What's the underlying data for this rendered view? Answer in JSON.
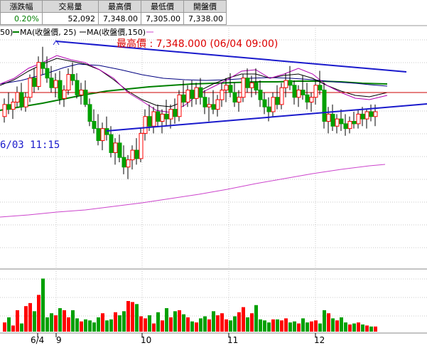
{
  "quote_table": {
    "headers": [
      "漲跌幅",
      "交易量",
      "最高價",
      "最低價",
      "開盤價"
    ],
    "values": [
      "0.20%",
      "52,092",
      "7,348.00",
      "7,305.00",
      "7,338.00"
    ]
  },
  "legend": {
    "ma_fragment_prefix": "50)",
    "ma25_label": "MA(收盤價, 25)",
    "ma150_label": "MA(收盤價,150)",
    "ma25_color": "#008000",
    "ma150_color": "#cc44cc"
  },
  "annotations": {
    "high_label": "最高價 : 7,348.000 (06/04 09:00)",
    "date_label": "6/03 11:15"
  },
  "colors": {
    "up": "#ff0000",
    "down": "#00a000",
    "trendline": "#1a1acc",
    "reference_line": "#cc0000",
    "ma_short": "#000080"
  },
  "chart_data": {
    "type": "candlestick",
    "x_labels": [
      "6/4",
      "9",
      "10",
      "11",
      "12"
    ],
    "candles": [
      [
        7290,
        7305,
        7285,
        7300
      ],
      [
        7300,
        7310,
        7292,
        7296
      ],
      [
        7296,
        7305,
        7288,
        7302
      ],
      [
        7302,
        7315,
        7298,
        7310
      ],
      [
        7310,
        7318,
        7295,
        7298
      ],
      [
        7298,
        7310,
        7294,
        7306
      ],
      [
        7306,
        7325,
        7302,
        7322
      ],
      [
        7322,
        7330,
        7310,
        7315
      ],
      [
        7315,
        7340,
        7312,
        7335
      ],
      [
        7335,
        7348,
        7325,
        7330
      ],
      [
        7330,
        7340,
        7318,
        7322
      ],
      [
        7322,
        7332,
        7310,
        7314
      ],
      [
        7314,
        7326,
        7306,
        7320
      ],
      [
        7320,
        7328,
        7300,
        7305
      ],
      [
        7305,
        7316,
        7298,
        7312
      ],
      [
        7312,
        7330,
        7308,
        7325
      ],
      [
        7325,
        7335,
        7316,
        7320
      ],
      [
        7320,
        7326,
        7305,
        7308
      ],
      [
        7308,
        7318,
        7300,
        7312
      ],
      [
        7312,
        7320,
        7298,
        7300
      ],
      [
        7300,
        7305,
        7282,
        7286
      ],
      [
        7286,
        7296,
        7276,
        7280
      ],
      [
        7280,
        7292,
        7266,
        7270
      ],
      [
        7270,
        7285,
        7262,
        7280
      ],
      [
        7280,
        7290,
        7270,
        7275
      ],
      [
        7275,
        7282,
        7256,
        7260
      ],
      [
        7260,
        7272,
        7250,
        7268
      ],
      [
        7268,
        7275,
        7252,
        7256
      ],
      [
        7256,
        7266,
        7242,
        7248
      ],
      [
        7248,
        7258,
        7238,
        7254
      ],
      [
        7254,
        7266,
        7246,
        7262
      ],
      [
        7262,
        7272,
        7250,
        7255
      ],
      [
        7255,
        7280,
        7252,
        7276
      ],
      [
        7276,
        7296,
        7270,
        7290
      ],
      [
        7290,
        7300,
        7278,
        7282
      ],
      [
        7282,
        7298,
        7276,
        7294
      ],
      [
        7294,
        7300,
        7282,
        7286
      ],
      [
        7286,
        7296,
        7276,
        7292
      ],
      [
        7292,
        7304,
        7282,
        7288
      ],
      [
        7288,
        7300,
        7280,
        7296
      ],
      [
        7296,
        7305,
        7284,
        7290
      ],
      [
        7290,
        7312,
        7286,
        7308
      ],
      [
        7308,
        7320,
        7298,
        7302
      ],
      [
        7302,
        7316,
        7298,
        7312
      ],
      [
        7312,
        7320,
        7298,
        7305
      ],
      [
        7305,
        7318,
        7300,
        7314
      ],
      [
        7314,
        7322,
        7300,
        7306
      ],
      [
        7306,
        7312,
        7292,
        7298
      ],
      [
        7298,
        7306,
        7286,
        7300
      ],
      [
        7300,
        7312,
        7292,
        7296
      ],
      [
        7296,
        7308,
        7290,
        7304
      ],
      [
        7304,
        7318,
        7298,
        7312
      ],
      [
        7312,
        7322,
        7302,
        7316
      ],
      [
        7316,
        7326,
        7306,
        7310
      ],
      [
        7310,
        7318,
        7298,
        7302
      ],
      [
        7302,
        7312,
        7294,
        7306
      ],
      [
        7306,
        7325,
        7302,
        7322
      ],
      [
        7322,
        7330,
        7310,
        7314
      ],
      [
        7314,
        7324,
        7306,
        7318
      ],
      [
        7318,
        7330,
        7308,
        7312
      ],
      [
        7312,
        7320,
        7298,
        7304
      ],
      [
        7304,
        7310,
        7292,
        7298
      ],
      [
        7298,
        7306,
        7286,
        7294
      ],
      [
        7294,
        7310,
        7290,
        7306
      ],
      [
        7306,
        7316,
        7296,
        7300
      ],
      [
        7300,
        7318,
        7296,
        7314
      ],
      [
        7314,
        7326,
        7306,
        7320
      ],
      [
        7320,
        7332,
        7312,
        7316
      ],
      [
        7316,
        7320,
        7300,
        7306
      ],
      [
        7306,
        7316,
        7298,
        7312
      ],
      [
        7312,
        7324,
        7304,
        7308
      ],
      [
        7308,
        7318,
        7296,
        7302
      ],
      [
        7302,
        7310,
        7294,
        7306
      ],
      [
        7306,
        7320,
        7300,
        7316
      ],
      [
        7316,
        7328,
        7308,
        7312
      ],
      [
        7312,
        7318,
        7280,
        7286
      ],
      [
        7286,
        7298,
        7276,
        7292
      ],
      [
        7292,
        7300,
        7278,
        7282
      ],
      [
        7282,
        7292,
        7276,
        7288
      ],
      [
        7288,
        7296,
        7278,
        7284
      ],
      [
        7284,
        7292,
        7274,
        7280
      ],
      [
        7280,
        7290,
        7276,
        7286
      ],
      [
        7286,
        7294,
        7280,
        7284
      ],
      [
        7284,
        7296,
        7280,
        7292
      ],
      [
        7292,
        7298,
        7282,
        7288
      ],
      [
        7288,
        7296,
        7280,
        7294
      ],
      [
        7294,
        7300,
        7286,
        7290
      ],
      [
        7290,
        7300,
        7282,
        7294
      ]
    ],
    "volumes": [
      9,
      14,
      6,
      21,
      8,
      25,
      28,
      20,
      36,
      52,
      14,
      18,
      16,
      23,
      21,
      14,
      21,
      13,
      10,
      12,
      11,
      9,
      14,
      18,
      11,
      12,
      19,
      16,
      20,
      30,
      29,
      27,
      15,
      13,
      16,
      8,
      19,
      11,
      23,
      14,
      20,
      21,
      17,
      14,
      10,
      9,
      13,
      15,
      12,
      20,
      16,
      18,
      12,
      11,
      15,
      19,
      24,
      14,
      18,
      26,
      12,
      11,
      9,
      12,
      12,
      11,
      13,
      9,
      10,
      8,
      13,
      9,
      10,
      11,
      8,
      21,
      18,
      13,
      11,
      14,
      9,
      7,
      8,
      9,
      7,
      6,
      5,
      5
    ],
    "reference_level": 7310,
    "price_range": [
      7165,
      7365
    ],
    "volume_max": 60
  }
}
